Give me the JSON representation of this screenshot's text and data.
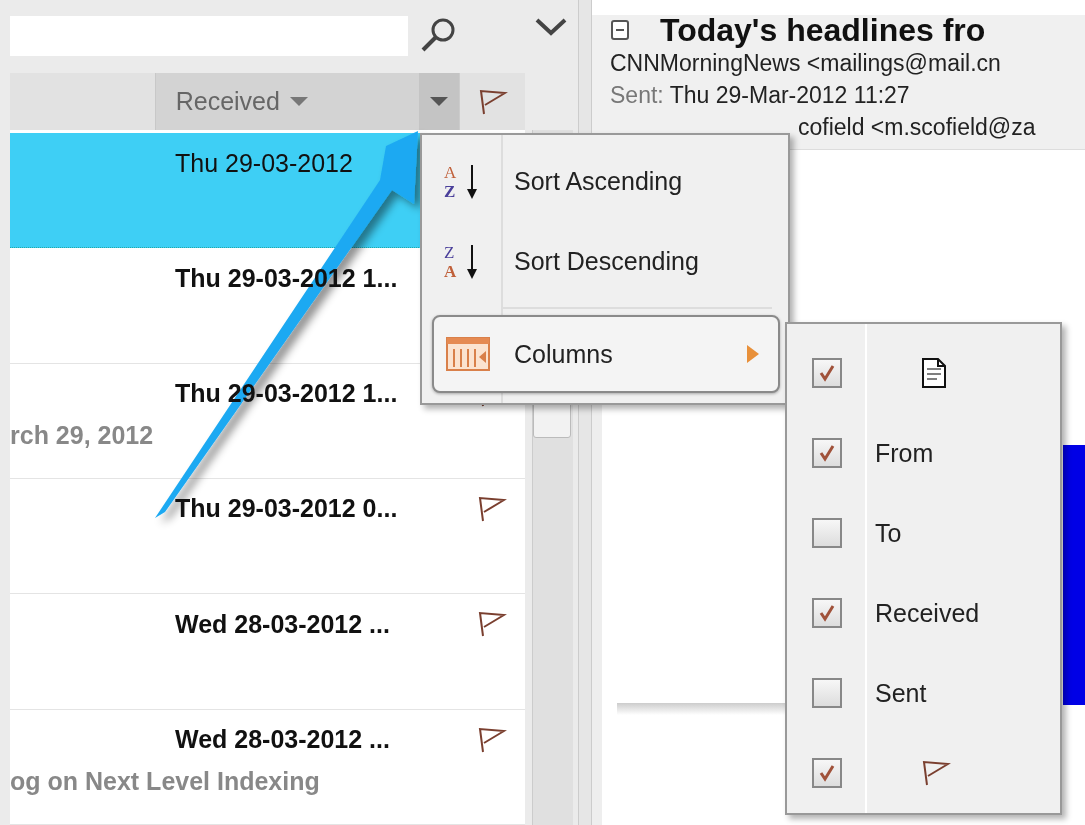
{
  "list_header": {
    "received_label": "Received"
  },
  "messages": [
    {
      "received": "Thu 29-03-2012",
      "selected": true,
      "unread": false,
      "flag": false
    },
    {
      "received": "Thu 29-03-2012 1...",
      "selected": false,
      "unread": true,
      "flag": false
    },
    {
      "received": "Thu 29-03-2012 1...",
      "preview": "rch 29, 2012",
      "selected": false,
      "unread": true,
      "flag": true
    },
    {
      "received": "Thu 29-03-2012 0...",
      "selected": false,
      "unread": true,
      "flag": true
    },
    {
      "received": "Wed 28-03-2012 ...",
      "selected": false,
      "unread": true,
      "flag": true
    },
    {
      "received": "Wed 28-03-2012 ...",
      "preview": "og on Next Level Indexing",
      "selected": false,
      "unread": true,
      "flag": true
    }
  ],
  "reading_pane": {
    "subject": "Today's headlines fro",
    "from": "CNNMorningNews <mailings@mail.cn",
    "sent_label": "Sent:",
    "sent": "Thu 29-Mar-2012 11:27",
    "to": "cofield <m.scofield@za"
  },
  "column_menu": {
    "items": [
      {
        "kind": "sort_ascending",
        "icon_letters": [
          "A",
          "Z"
        ],
        "label": "Sort Ascending",
        "highlighted": false
      },
      {
        "kind": "sort_descending",
        "icon_letters": [
          "Z",
          "A"
        ],
        "label": "Sort Descending",
        "highlighted": false
      },
      {
        "kind": "submenu",
        "label": "Columns",
        "highlighted": true
      }
    ]
  },
  "columns_submenu": [
    {
      "kind": "document_icon",
      "checked": true
    },
    {
      "kind": "text",
      "label": "From",
      "checked": true
    },
    {
      "kind": "text",
      "label": "To",
      "checked": false
    },
    {
      "kind": "text",
      "label": "Received",
      "checked": true
    },
    {
      "kind": "text",
      "label": "Sent",
      "checked": false
    },
    {
      "kind": "flag_icon",
      "checked": true
    }
  ]
}
